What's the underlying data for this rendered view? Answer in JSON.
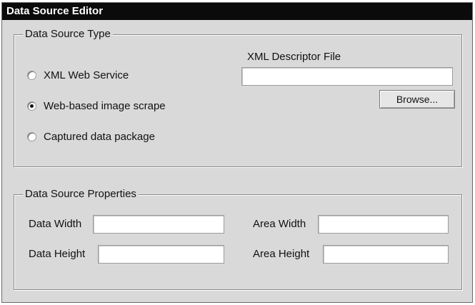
{
  "window": {
    "title": "Data Source Editor"
  },
  "source_type": {
    "legend": "Data Source Type",
    "options": [
      {
        "label": "XML Web Service",
        "selected": false
      },
      {
        "label": "Web-based image scrape",
        "selected": true
      },
      {
        "label": "Captured data package",
        "selected": false
      }
    ],
    "descriptor_label": "XML Descriptor File",
    "descriptor_value": "",
    "browse_label": "Browse..."
  },
  "properties": {
    "legend": "Data Source Properties",
    "data_width_label": "Data Width",
    "data_width_value": "",
    "data_height_label": "Data Height",
    "data_height_value": "",
    "area_width_label": "Area Width",
    "area_width_value": "",
    "area_height_label": "Area Height",
    "area_height_value": ""
  },
  "colors": {
    "titlebar": "#0b0b0b",
    "window_bg": "#d9d9d9",
    "field_bg": "#ffffff"
  }
}
